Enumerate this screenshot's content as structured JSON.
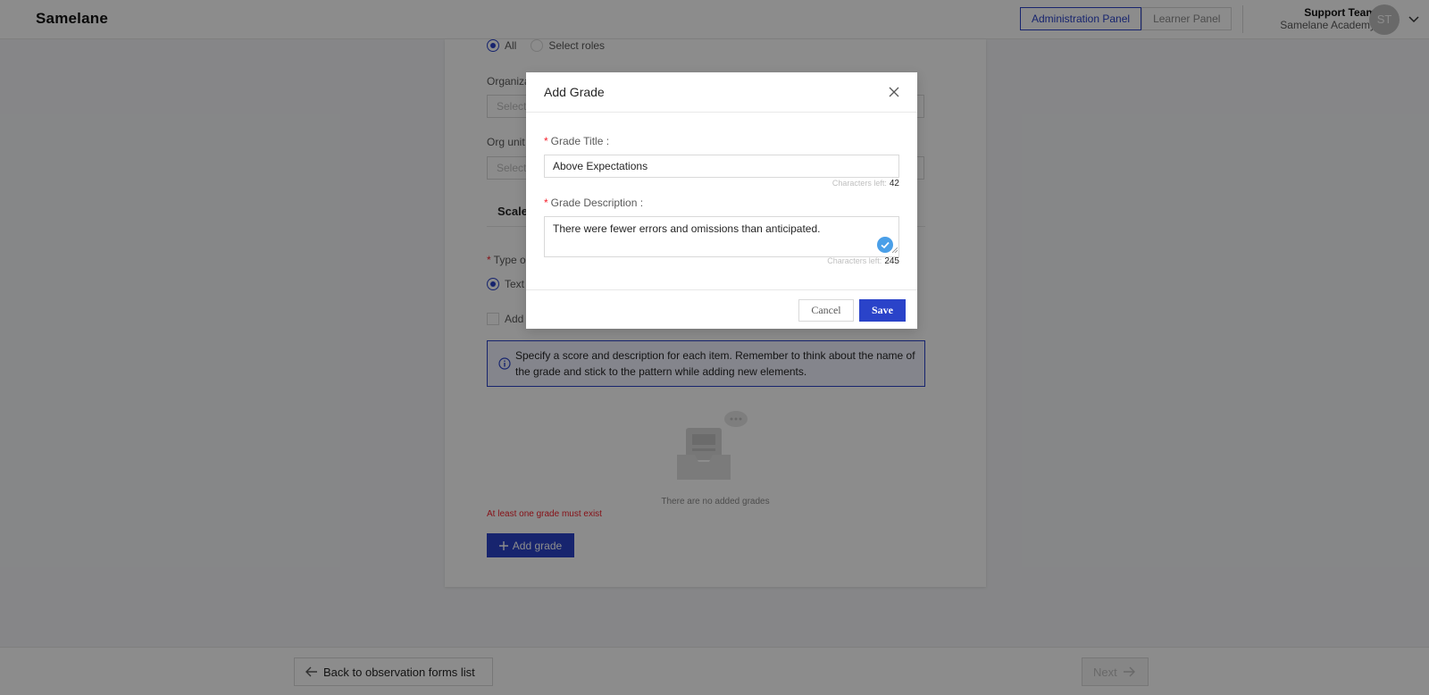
{
  "header": {
    "logo": "Samelane",
    "panels": {
      "admin": "Administration Panel",
      "learner": "Learner Panel"
    },
    "user": {
      "name": "Support Team",
      "org": "Samelane Academy",
      "initials": "ST"
    }
  },
  "form": {
    "roles": {
      "all_label": "All",
      "select_label": "Select roles"
    },
    "organization_label": "Organiza",
    "organization_placeholder": "Select",
    "org_unit_label": "Org unit",
    "org_unit_placeholder": "Select",
    "scale_tab": "Scale",
    "type_label": "Type o",
    "type_option": "Text",
    "add_checkbox_label": "Add",
    "info_text": "Specify a score and description for each item. Remember to think about the name of the grade and stick to the pattern while adding new elements.",
    "empty_text": "There are no added grades",
    "error_text": "At least one grade must exist",
    "add_grade_label": "Add grade"
  },
  "footer": {
    "back_label": "Back to observation forms list",
    "next_label": "Next"
  },
  "modal": {
    "title": "Add Grade",
    "grade_title_label": "Grade Title",
    "grade_title_value": "Above Expectations",
    "grade_title_chars_label": "Characters left:",
    "grade_title_chars_left": "42",
    "grade_description_label": "Grade Description",
    "grade_description_value": "There were fewer errors and omissions than anticipated.",
    "grade_description_chars_label": "Characters left:",
    "grade_description_chars_left": "245",
    "cancel_label": "Cancel",
    "save_label": "Save"
  },
  "colors": {
    "primary": "#2a43c9",
    "error": "#f5222d",
    "info_bg": "#f0f3ff"
  }
}
